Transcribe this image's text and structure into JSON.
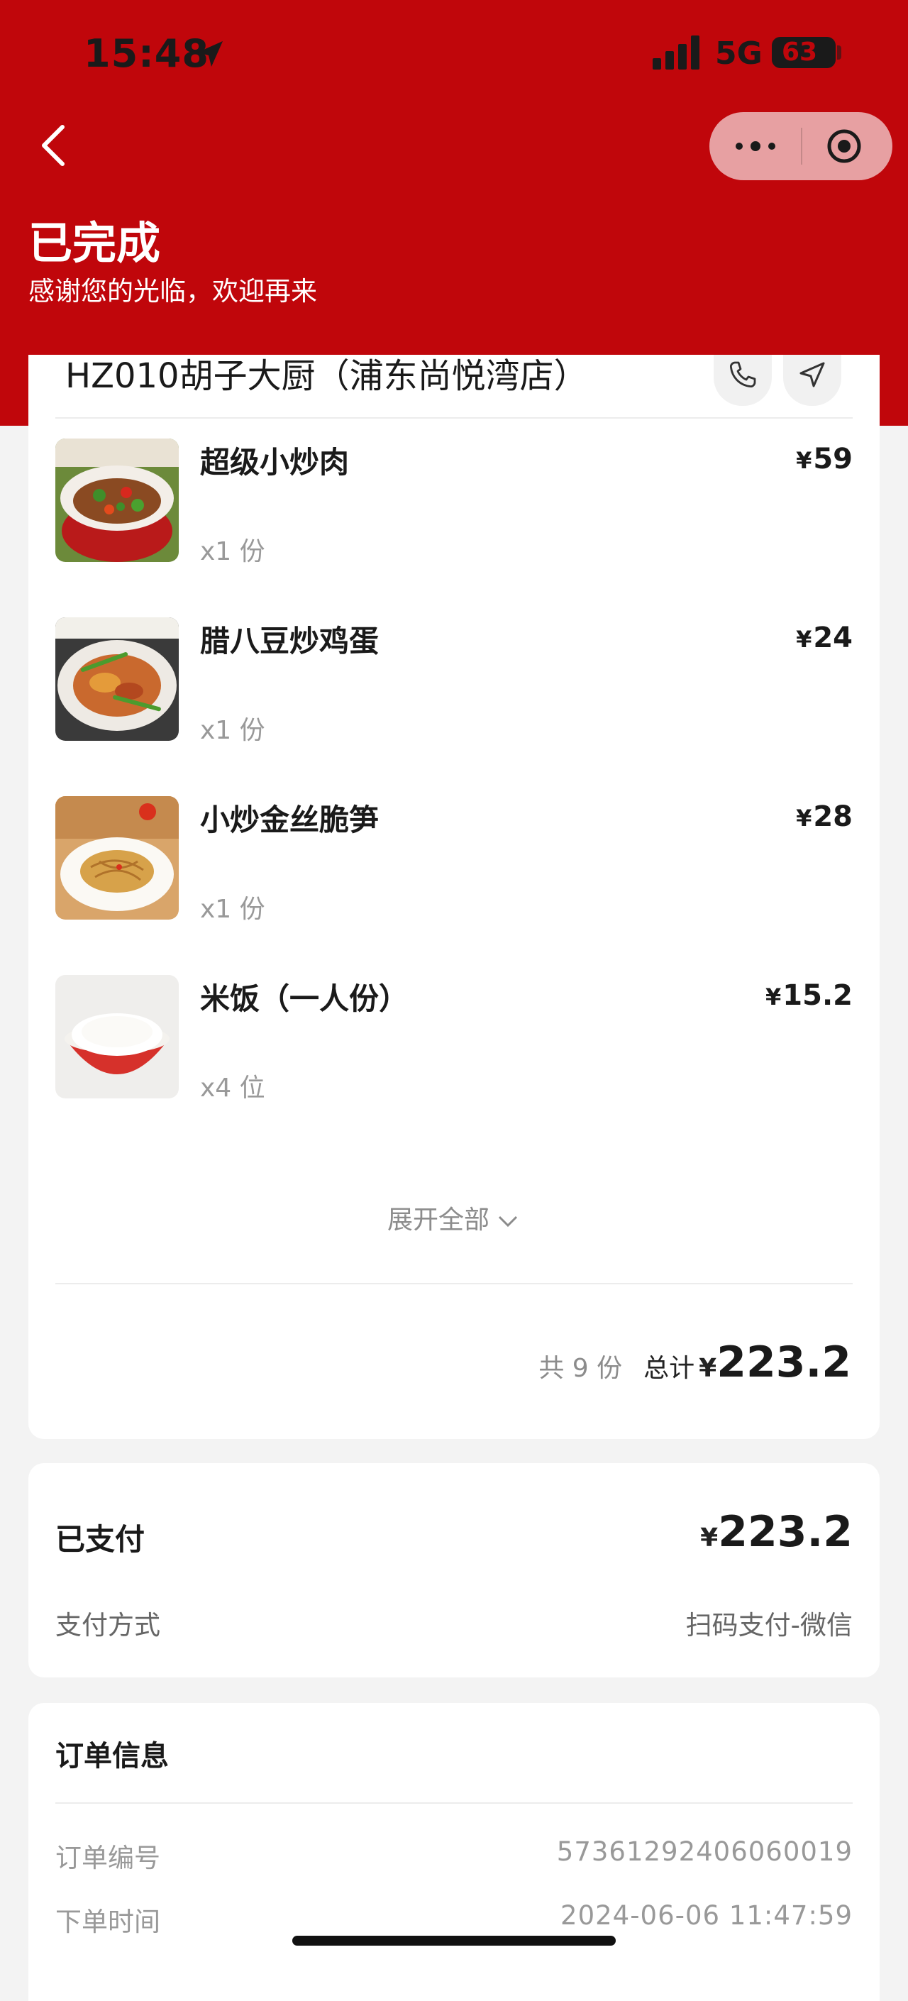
{
  "status_bar": {
    "time": "15:48",
    "network": "5G",
    "battery": "63"
  },
  "header": {
    "title": "已完成",
    "subtitle": "感谢您的光临，欢迎再来"
  },
  "store": {
    "name": "HZ010胡子大厨（浦东尚悦湾店）"
  },
  "items": [
    {
      "name": "超级小炒肉",
      "qty": "x1 份",
      "currency": "¥",
      "price": "59"
    },
    {
      "name": "腊八豆炒鸡蛋",
      "qty": "x1 份",
      "currency": "¥",
      "price": "24"
    },
    {
      "name": "小炒金丝脆笋",
      "qty": "x1 份",
      "currency": "¥",
      "price": "28"
    },
    {
      "name": "米饭（一人份）",
      "qty": "x4 位",
      "currency": "¥",
      "price": "15.2"
    }
  ],
  "expand_label": "展开全部",
  "summary": {
    "count": "共 9 份",
    "label": "总计",
    "currency": "¥",
    "amount": "223.2"
  },
  "payment": {
    "label": "已支付",
    "currency": "¥",
    "amount": "223.2",
    "method_label": "支付方式",
    "method_value": "扫码支付-微信"
  },
  "order_info": {
    "title": "订单信息",
    "rows": [
      {
        "label": "订单编号",
        "value": "57361292406060019"
      },
      {
        "label": "下单时间",
        "value": "2024-06-06 11:47:59"
      }
    ]
  },
  "colors": {
    "brand_red": "#c0060b",
    "background": "#f3f3f3"
  },
  "icons": [
    "location-arrow-icon",
    "signal-icon",
    "back-arrow-icon",
    "more-dots-icon",
    "target-icon",
    "phone-icon",
    "navigate-icon",
    "chevron-down-icon"
  ]
}
